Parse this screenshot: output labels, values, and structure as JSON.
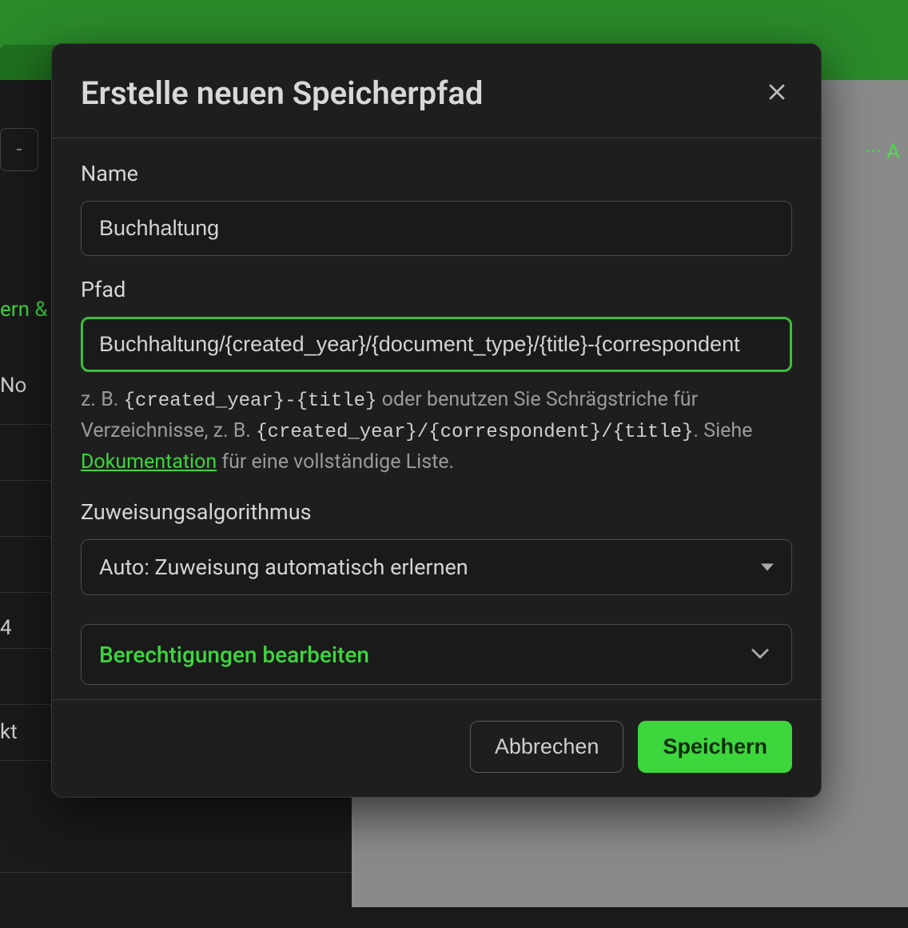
{
  "dialog": {
    "title": "Erstelle neuen Speicherpfad",
    "name_label": "Name",
    "name_value": "Buchhaltung",
    "path_label": "Pfad",
    "path_value": "Buchhaltung/{created_year}/{document_type}/{title}-{correspondent",
    "help_prefix": "z. B. ",
    "help_code1": "{created_year}-{title}",
    "help_mid": " oder benutzen Sie Schrägstriche für Verzeichnisse, z. B. ",
    "help_code2": "{created_year}/{correspondent}/{title}",
    "help_see": ". Siehe ",
    "doc_link": "Dokumentation",
    "help_suffix": " für eine vollständige Liste.",
    "algorithm_label": "Zuweisungsalgorithmus",
    "algorithm_value": "Auto: Zuweisung automatisch erlernen",
    "permissions_label": "Berechtigungen bearbeiten",
    "cancel": "Abbrechen",
    "save": "Speichern"
  },
  "background": {
    "toolbar_right": "··· A",
    "toolbar_left": "-",
    "side_green": "ern &",
    "side_text_1": "No",
    "side_text_2": "4",
    "side_text_3": "kt"
  }
}
